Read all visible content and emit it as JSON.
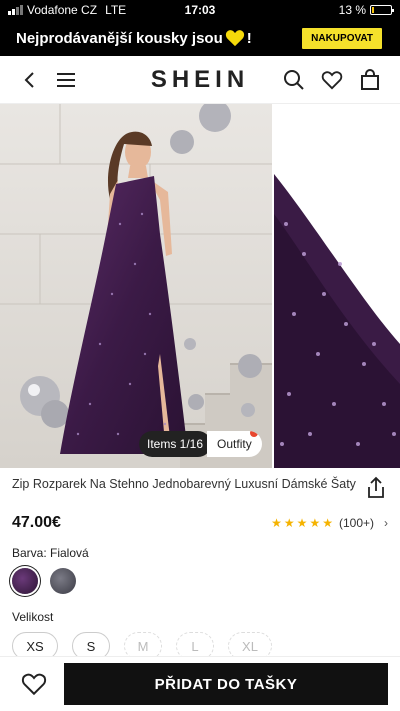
{
  "status": {
    "carrier": "Vodafone CZ",
    "network": "LTE",
    "time": "17:03",
    "battery": "13 %"
  },
  "promo": {
    "text": "Nejprodávanější kousky jsou",
    "suffix": "!",
    "cta": "NAKUPOVAT",
    "heart_color": "#f5d90a"
  },
  "header": {
    "logo": "SHEIN",
    "icons": [
      "back-icon",
      "menu-icon",
      "search-icon",
      "heart-icon",
      "bag-icon"
    ]
  },
  "gallery": {
    "counter": "Items 1/16",
    "outfit": "Outfity"
  },
  "product": {
    "title": "Zip Rozparek Na Stehno Jednobarevný Luxusní Dámské Šaty",
    "price": "47.00€",
    "rating_stars": 4.5,
    "rating_count": "(100+)"
  },
  "color": {
    "label": "Barva: Fialová",
    "options": [
      "purple",
      "grey"
    ],
    "selected": 0
  },
  "size": {
    "label": "Velikost",
    "options": [
      {
        "label": "XS",
        "available": true
      },
      {
        "label": "S",
        "available": true
      },
      {
        "label": "M",
        "available": false
      },
      {
        "label": "L",
        "available": false
      },
      {
        "label": "XL",
        "available": false
      }
    ]
  },
  "cta": {
    "add_to_bag": "PŘIDAT DO TAŠKY"
  }
}
